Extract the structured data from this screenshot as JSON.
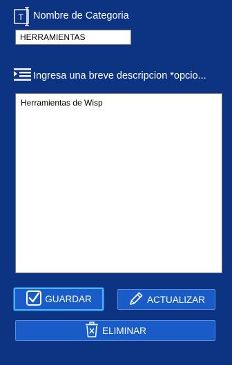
{
  "category": {
    "label": "Nombre de Categoria",
    "value": "HERRAMIENTAS",
    "icon": "text-field-icon"
  },
  "description": {
    "label": "Ingresa una breve descripcion *opcio...",
    "value": "Herramientas de Wisp",
    "icon": "list-lines-icon"
  },
  "buttons": {
    "save": {
      "label": "GUARDAR",
      "icon": "checkbox-icon"
    },
    "update": {
      "label": "ACTUALIZAR",
      "icon": "pencil-icon"
    },
    "delete": {
      "label": "ELIMINAR",
      "icon": "trash-icon"
    }
  },
  "colors": {
    "background": "#0d3383",
    "button": "#1a5cc7",
    "focus_border": "#4fb2f2"
  }
}
